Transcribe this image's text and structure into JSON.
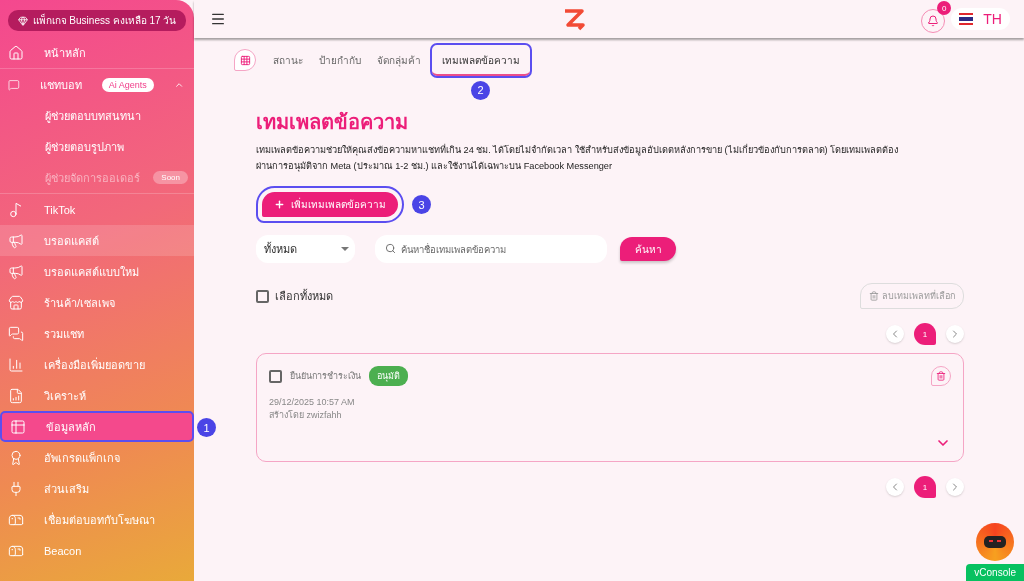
{
  "sidebar": {
    "plan_badge": "แพ็กเกจ Business คงเหลือ 17 วัน",
    "items": [
      {
        "label": "หน้าหลัก",
        "selected": false,
        "hovered": false
      },
      {
        "label": "แชทบอท",
        "selected": false,
        "hovered": false,
        "badge": "Ai Agents",
        "expanded": true,
        "children": [
          {
            "label": "ผู้ช่วยตอบบทสนทนา",
            "disabled": false
          },
          {
            "label": "ผู้ช่วยตอบรูปภาพ",
            "disabled": false
          },
          {
            "label": "ผู้ช่วยจัดการออเดอร์",
            "disabled": true,
            "badge": "Soon"
          }
        ]
      },
      {
        "label": "TikTok",
        "selected": false,
        "hovered": false
      },
      {
        "label": "บรอดแคสต์",
        "selected": false,
        "hovered": true
      },
      {
        "label": "บรอดแคสต์แบบใหม่",
        "selected": false,
        "hovered": false
      },
      {
        "label": "ร้านค้า/เซลเพจ",
        "selected": false,
        "hovered": false
      },
      {
        "label": "รวมแชท",
        "selected": false,
        "hovered": false
      },
      {
        "label": "เครื่องมือเพิ่มยอดขาย",
        "selected": false,
        "hovered": false
      },
      {
        "label": "วิเคราะห์",
        "selected": false,
        "hovered": false
      },
      {
        "label": "ข้อมูลหลัก",
        "selected": true,
        "hovered": false,
        "annotation": "1"
      },
      {
        "label": "อัพเกรดแพ็กเกจ",
        "selected": false,
        "hovered": false
      },
      {
        "label": "ส่วนเสริม",
        "selected": false,
        "hovered": false
      },
      {
        "label": "เชื่อมต่อบอทกับโฆษณา",
        "selected": false,
        "hovered": false
      },
      {
        "label": "Beacon",
        "selected": false,
        "hovered": false
      }
    ]
  },
  "header": {
    "notification_count": "0",
    "language": "TH"
  },
  "tabs": [
    {
      "label": "สถานะ",
      "selected": false
    },
    {
      "label": "ป้ายกำกับ",
      "selected": false
    },
    {
      "label": "จัดกลุ่มค้า",
      "selected": false
    },
    {
      "label": "เทมเพลตข้อความ",
      "selected": true,
      "annotation": "2"
    }
  ],
  "page": {
    "title": "เทมเพลตข้อความ",
    "description": "เทมเพลตข้อความช่วยให้คุณส่งข้อความหาแชทที่เกิน 24 ชม. ได้โดยไม่จำกัดเวลา ใช้สำหรับส่งข้อมูลอัปเดตหลังการขาย (ไม่เกี่ยวข้องกับการตลาด) โดยเทมเพลตต้องผ่านการอนุมัติจาก Meta (ประมาณ 1-2 ชม.) และใช้งานได้เฉพาะบน Facebook Messenger"
  },
  "add_button": {
    "label": "เพิ่มเทมเพลตข้อความ",
    "annotation": "3"
  },
  "filter": {
    "value": "ทั้งหมด"
  },
  "search": {
    "placeholder": "ค้นหาชื่อเทมเพลตข้อความ",
    "button": "ค้นหา"
  },
  "select_all": {
    "label": "เลือกทั้งหมด",
    "checked": false
  },
  "delete_selected": {
    "label": "ลบเทมเพลทที่เลือก",
    "disabled": true
  },
  "pagination_top": [
    {
      "label": "1",
      "selected": true
    }
  ],
  "templates": [
    {
      "name": "ยืนยันการชำระเงิน",
      "status": "อนุมัติ",
      "color": "#4caf50",
      "checked": false,
      "date": "29/12/2025 10:57 AM",
      "author": "สร้างโดย zwizfahh"
    }
  ],
  "pagination_bottom": [
    {
      "label": "1",
      "selected": true
    }
  ],
  "vconsole": "vConsole"
}
